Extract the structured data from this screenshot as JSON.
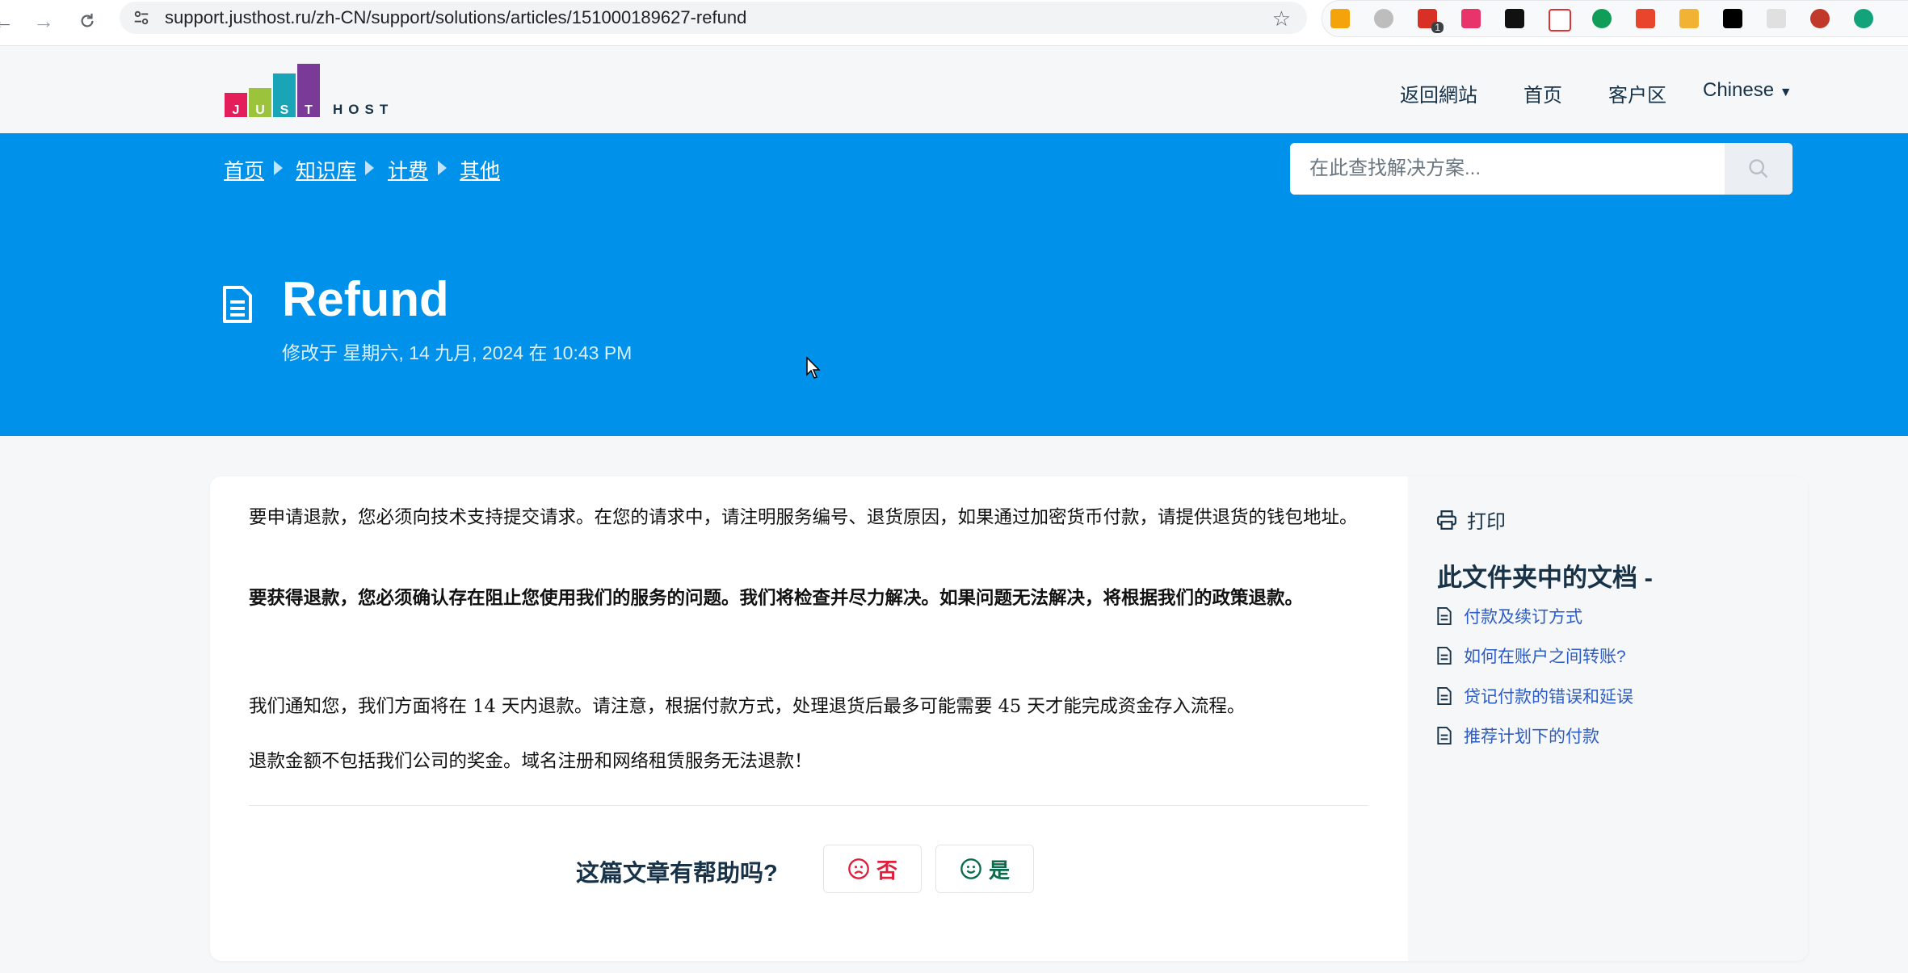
{
  "browser": {
    "url": "support.justhost.ru/zh-CN/support/solutions/articles/151000189627-refund",
    "extension_badge": "1"
  },
  "logo": {
    "letters": [
      "J",
      "U",
      "S",
      "T"
    ],
    "word": "HOST"
  },
  "nav": {
    "back_to_site": "返回網站",
    "home": "首页",
    "client_area": "客户区",
    "language": "Chinese"
  },
  "breadcrumb": [
    "首页",
    "知识库",
    "计费",
    "其他"
  ],
  "search": {
    "placeholder": "在此查找解决方案..."
  },
  "article": {
    "title": "Refund",
    "modified": "修改于 星期六, 14 九月, 2024 在 10:43 PM",
    "paragraphs": [
      "要申请退款，您必须向技术支持提交请求。在您的请求中，请注明服务编号、退货原因，如果通过加密货币付款，请提供退货的钱包地址。",
      "要获得退款，您必须确认存在阻止您使用我们的服务的问题。我们将检查并尽力解决。如果问题无法解决，将根据我们的政策退款。",
      "我们通知您，我们方面将在 14 天内退款。请注意，根据付款方式，处理退货后最多可能需要 45 天才能完成资金存入流程。",
      "退款金额不包括我们公司的奖金。域名注册和网络租赁服务无法退款！"
    ]
  },
  "feedback": {
    "question": "这篇文章有帮助吗?",
    "no": "否",
    "yes": "是"
  },
  "sidebar": {
    "print": "打印",
    "folder_title": "此文件夹中的文档 -",
    "items": [
      "付款及续订方式",
      "如何在账户之间转账?",
      "贷记付款的错误和延误",
      "推荐计划下的付款"
    ]
  },
  "colors": {
    "hero": "#0091ea",
    "link": "#2c5cc5",
    "no": "#e01f3d",
    "yes": "#0b6c4b"
  },
  "icons": [
    "back-icon",
    "forward-icon",
    "reload-icon",
    "site-info-icon",
    "bookmark-star-icon",
    "document-icon",
    "search-icon",
    "print-icon",
    "sad-face-icon",
    "smile-face-icon",
    "cursor-icon"
  ]
}
